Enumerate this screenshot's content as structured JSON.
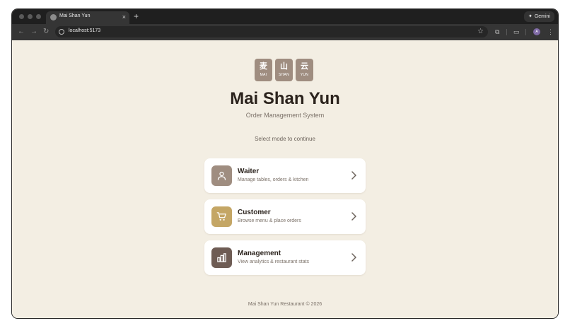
{
  "browser": {
    "tab_title": "Mai Shan Yun",
    "tab_close": "×",
    "new_tab": "+",
    "url": "localhost:5173",
    "gemini_label": "Gemini",
    "profile_initial": "A"
  },
  "logo": {
    "tiles": [
      {
        "char": "麦",
        "roman": "MAI"
      },
      {
        "char": "山",
        "roman": "SHAN"
      },
      {
        "char": "云",
        "roman": "YUN"
      }
    ]
  },
  "header": {
    "title": "Mai Shan Yun",
    "subtitle": "Order Management System"
  },
  "prompt": "Select mode to continue",
  "modes": [
    {
      "title": "Waiter",
      "description": "Manage tables, orders & kitchen",
      "icon": "person-icon",
      "color": "#9f8d80"
    },
    {
      "title": "Customer",
      "description": "Browse menu & place orders",
      "icon": "cart-icon",
      "color": "#c4a665"
    },
    {
      "title": "Management",
      "description": "View analytics & restaurant stats",
      "icon": "bar-chart-icon",
      "color": "#6e5c54"
    }
  ],
  "footer": "Mai Shan Yun Restaurant © 2026",
  "colors": {
    "background": "#f3eee3",
    "title": "#2b231d",
    "muted": "#7b7168"
  }
}
